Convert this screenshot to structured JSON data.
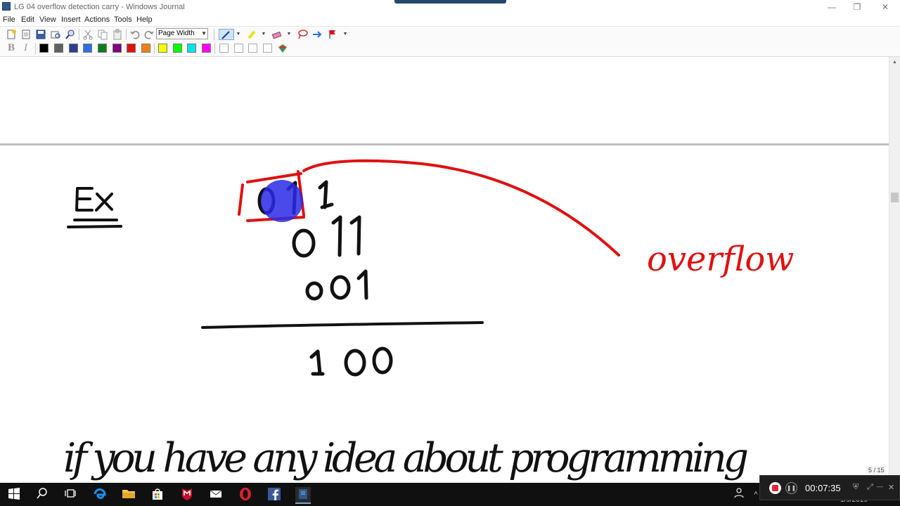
{
  "window": {
    "title": "LG 04 overflow detection carry - Windows Journal",
    "minimize_icon": "—",
    "maximize_icon": "❐",
    "close_icon": "✕"
  },
  "menu": {
    "items": [
      "File",
      "Edit",
      "View",
      "Insert",
      "Actions",
      "Tools",
      "Help"
    ]
  },
  "toolbar": {
    "zoom_value": "Page Width",
    "icons": [
      "new-note-icon",
      "open-icon",
      "save-icon",
      "print-preview-icon",
      "find-icon",
      "cut-icon",
      "copy-icon",
      "paste-icon",
      "undo-icon",
      "redo-icon",
      "pen-icon",
      "highlighter-icon",
      "eraser-icon",
      "lasso-select-icon",
      "insert-space-icon",
      "flag-icon"
    ]
  },
  "format_bar": {
    "bold_label": "B",
    "italic_label": "I",
    "colors": [
      "#000000",
      "#606060",
      "#2b3d94",
      "#2f6fe0",
      "#0b7d1e",
      "#800080",
      "#e01010",
      "#f08010",
      "#ffff00",
      "#00ff00",
      "#00e5e5",
      "#ff00ff",
      "#ffffff",
      "#ffffff",
      "#ffffff",
      "#ffffff"
    ]
  },
  "ink": {
    "ex_label": "Ex",
    "carry_row": "0 1 1",
    "operand1": "0 1 1",
    "operand2": "0 0 1",
    "result": "1 0 0",
    "overflow_label": "overflow",
    "sentence": "if you have any idea about programming",
    "ink_color": "#111111",
    "annotation_color": "#e01010",
    "pointer_color": "#2a2ae8"
  },
  "status": {
    "page_indicator": "5 / 15"
  },
  "taskbar": {
    "icons": [
      "start-icon",
      "search-icon",
      "task-view-icon",
      "edge-icon",
      "file-explorer-icon",
      "store-icon",
      "mcafee-icon",
      "mail-icon",
      "opera-icon",
      "facebook-icon",
      "journal-app-icon"
    ],
    "clock": "1/9/2019"
  },
  "recorder": {
    "time": "00:07:35"
  }
}
